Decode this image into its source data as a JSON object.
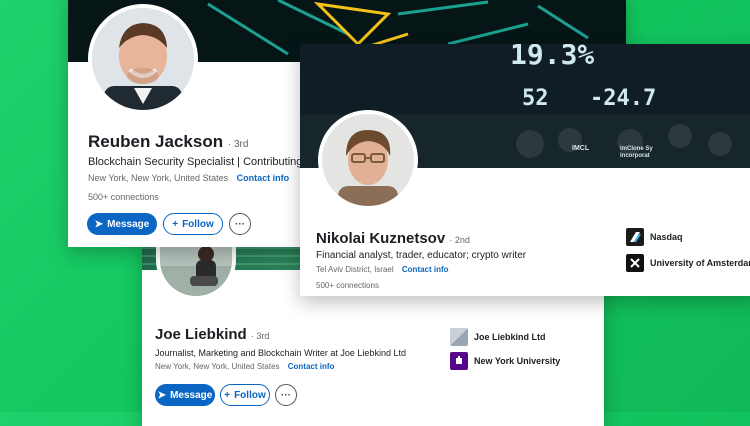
{
  "colors": {
    "background": "#18cc63",
    "primary": "#0a66c2",
    "nasdaq": "#1a1a1a",
    "uva": "#111111",
    "nyu": "#57068c"
  },
  "cards": {
    "reuben": {
      "name": "Reuben Jackson",
      "degree": "· 3rd",
      "headline": "Blockchain Security Specialist | Contributing",
      "location": "New York, New York, United States",
      "contact": "Contact info",
      "connections": "500+ connections",
      "message": "Message",
      "follow": "Follow",
      "more": "···"
    },
    "nikolai": {
      "name": "Nikolai Kuznetsov",
      "degree": "· 2nd",
      "headline": "Financial analyst, trader, educator; crypto writer",
      "location": "Tel Aviv District, Israel",
      "contact": "Contact info",
      "connections": "500+ connections",
      "banner_numbers": [
        "19.3%",
        "52",
        "-24.7"
      ],
      "banner_tickers": [
        "IMCL",
        "ImClone Sy Incorporat"
      ],
      "orgs": [
        {
          "name": "Nasdaq",
          "icon": "nasdaq-logo-icon"
        },
        {
          "name": "University of Amsterdam",
          "icon": "uva-logo-icon"
        }
      ]
    },
    "joe": {
      "name": "Joe Liebkind",
      "degree": "· 3rd",
      "headline": "Journalist, Marketing and Blockchain Writer at Joe Liebkind Ltd",
      "location": "New York, New York, United States",
      "contact": "Contact info",
      "message": "Message",
      "follow": "Follow",
      "more": "···",
      "orgs": [
        {
          "name": "Joe Liebkind Ltd",
          "icon": "company-logo-icon"
        },
        {
          "name": "New York University",
          "icon": "nyu-logo-icon"
        }
      ]
    }
  }
}
